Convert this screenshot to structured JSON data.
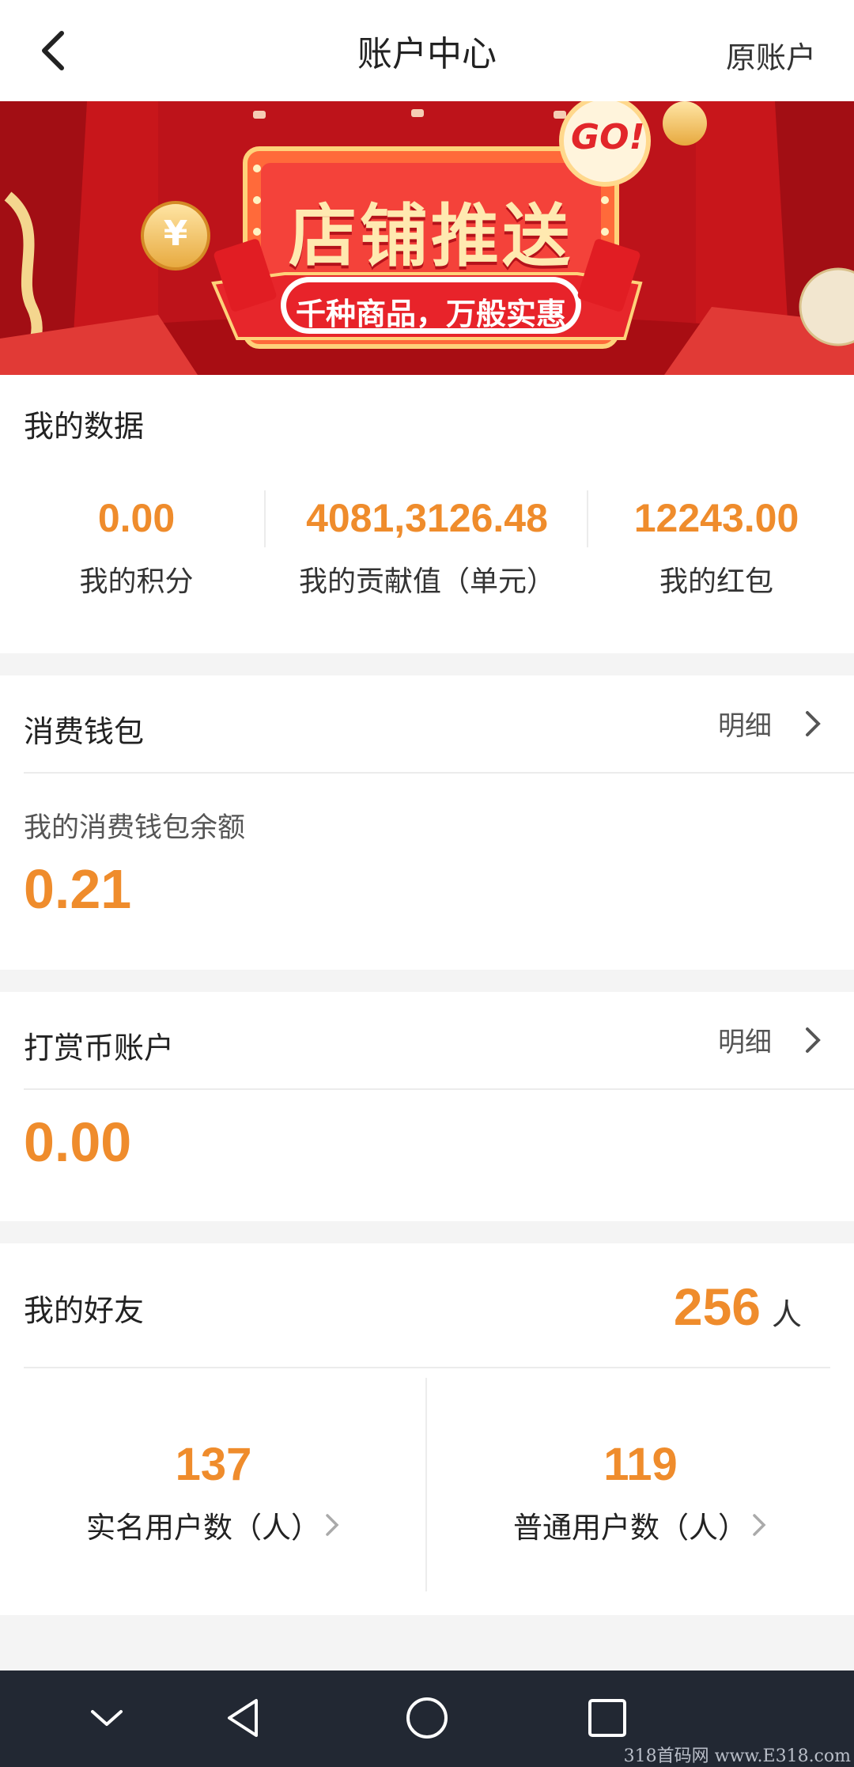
{
  "header": {
    "title": "账户中心",
    "right_link": "原账户"
  },
  "banner": {
    "headline": "店铺推送",
    "subtitle": "千种商品，万般实惠",
    "badge": "GO!",
    "coin_symbol": "¥",
    "active_dot": 0,
    "dot_count": 2
  },
  "my_data": {
    "title": "我的数据",
    "stats": [
      {
        "value": "0.00",
        "label": "我的积分"
      },
      {
        "value": "4081,3126.48",
        "label": "我的贡献值（单元）"
      },
      {
        "value": "12243.00",
        "label": "我的红包"
      }
    ]
  },
  "wallet": {
    "title": "消费钱包",
    "detail_label": "明细",
    "balance_label": "我的消费钱包余额",
    "balance": "0.21"
  },
  "tip_account": {
    "title": "打赏币账户",
    "detail_label": "明细",
    "balance": "0.00"
  },
  "friends": {
    "title": "我的好友",
    "total": "256",
    "unit": "人",
    "groups": [
      {
        "value": "137",
        "label": "实名用户数（人）"
      },
      {
        "value": "119",
        "label": "普通用户数（人）"
      }
    ]
  },
  "watermark": "318首码网 www.E318.com",
  "colors": {
    "accent": "#ef8c2c",
    "banner_red": "#e2262a",
    "navbar": "#222833"
  }
}
